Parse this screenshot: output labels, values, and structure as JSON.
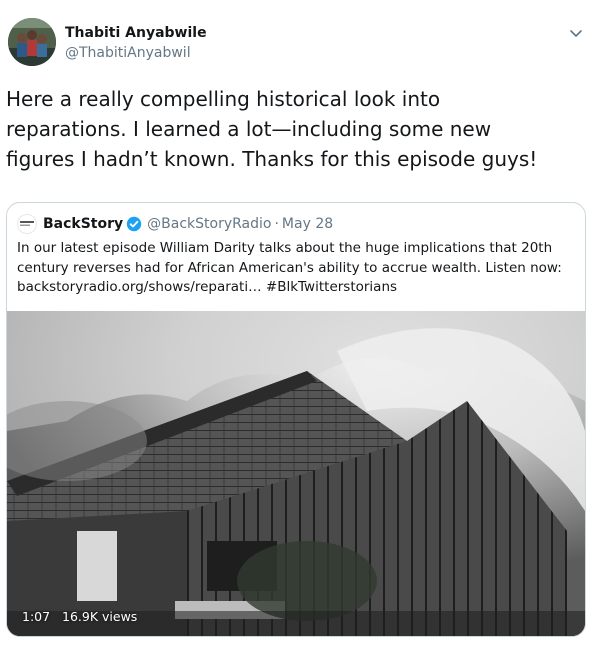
{
  "author": {
    "display_name": "Thabiti Anyabwile",
    "handle": "@ThabitiAnyabwil"
  },
  "tweet": {
    "text_lines": [
      "Here a really compelling historical look into",
      "reparations. I learned a lot—including some new",
      "figures I hadn’t known. Thanks for this episode guys!"
    ]
  },
  "quoted_tweet": {
    "display_name": "BackStory",
    "verified": true,
    "handle": "@BackStoryRadio",
    "separator": "·",
    "date": "May 28",
    "avatar_text": "BACK STORY",
    "text_lines": [
      "In our latest episode William Darity talks about the huge implications that 20th",
      "century reverses had for African American's ability to accrue wealth. Listen now:"
    ],
    "link_text": "backstoryradio.org/shows/reparati…",
    "hashtag": "#BlkTwitterstorians",
    "media": {
      "type": "video",
      "duration": "1:07",
      "views": "16.9K views"
    }
  },
  "icons": {
    "caret": "chevron-down-icon",
    "verified": "verified-badge-icon"
  },
  "colors": {
    "text": "#14171a",
    "secondary": "#657786",
    "border": "#ccd6dd",
    "verified": "#1da1f2"
  }
}
